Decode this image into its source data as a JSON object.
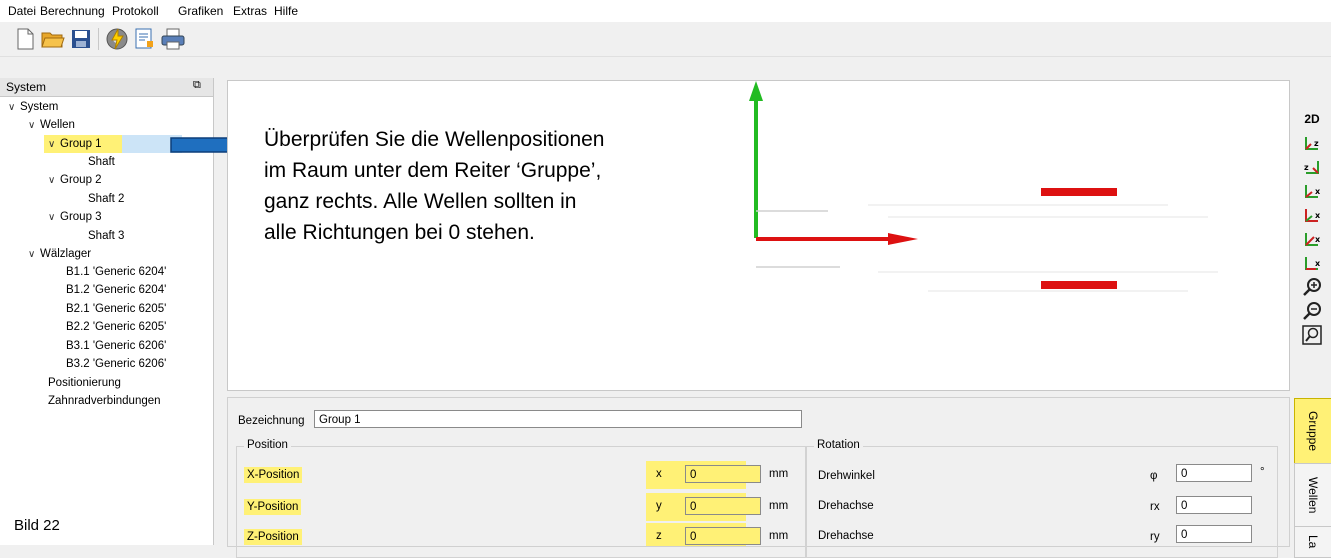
{
  "menu": [
    "Datei",
    "Berechnung",
    "Protokoll",
    "Grafiken",
    "Extras",
    "Hilfe"
  ],
  "toolbar_icons": [
    "new-file-icon",
    "open-folder-icon",
    "save-icon",
    "calculate-icon",
    "report-icon",
    "print-icon"
  ],
  "left_panel": {
    "title": "System",
    "float_icon": "⧉",
    "tree": [
      {
        "label": "System",
        "expanded": true
      },
      {
        "label": "Wellen",
        "expanded": true
      },
      {
        "label": "Group 1",
        "expanded": true
      },
      {
        "label": "Shaft"
      },
      {
        "label": "Group 2",
        "expanded": true
      },
      {
        "label": "Shaft 2"
      },
      {
        "label": "Group 3",
        "expanded": true
      },
      {
        "label": "Shaft 3"
      },
      {
        "label": "Wälzlager",
        "expanded": true
      },
      {
        "label": "B1.1 'Generic 6204'"
      },
      {
        "label": "B1.2 'Generic 6204'"
      },
      {
        "label": "B2.1 'Generic 6205'"
      },
      {
        "label": "B2.2 'Generic 6205'"
      },
      {
        "label": "B3.1 'Generic 6206'"
      },
      {
        "label": "B3.2 'Generic 6206'"
      },
      {
        "label": "Positionierung"
      },
      {
        "label": "Zahnradverbindungen"
      }
    ]
  },
  "annotation": {
    "text_lines": [
      "Überprüfen Sie die Wellenpositionen",
      "im Raum unter dem Reiter ‘Gruppe’,",
      "ganz rechts. Alle Wellen sollten in",
      "alle Richtungen bei 0 stehen."
    ],
    "figure_label": "Bild 22"
  },
  "view_icons": {
    "mode_2d": "2D",
    "items": [
      "view-yz-icon",
      "view-zy-icon",
      "view-zx-icon",
      "view-xz-icon",
      "view-iso-icon",
      "view-yx-icon",
      "zoom-in-icon",
      "zoom-out-icon",
      "zoom-fit-icon"
    ]
  },
  "properties": {
    "bezeichnung_label": "Bezeichnung",
    "bezeichnung_value": "Group 1",
    "position": {
      "title": "Position",
      "rows": [
        {
          "label": "X-Position",
          "sym": "x",
          "value": "0",
          "unit": "mm"
        },
        {
          "label": "Y-Position",
          "sym": "y",
          "value": "0",
          "unit": "mm"
        },
        {
          "label": "Z-Position",
          "sym": "z",
          "value": "0",
          "unit": "mm"
        }
      ]
    },
    "rotation": {
      "title": "Rotation",
      "rows": [
        {
          "label": "Drehwinkel",
          "sym": "φ",
          "value": "0",
          "unit": "°"
        },
        {
          "label": "Drehachse",
          "sym": "rx",
          "value": "0",
          "unit": ""
        },
        {
          "label": "Drehachse",
          "sym": "ry",
          "value": "0",
          "unit": ""
        }
      ]
    }
  },
  "tabs": [
    "Gruppe",
    "Wellen",
    "La"
  ],
  "colors": {
    "highlight": "#fff176",
    "axis_green": "#22bb22",
    "axis_red": "#dd1111",
    "arrow_blue": "#1f6fbf"
  }
}
